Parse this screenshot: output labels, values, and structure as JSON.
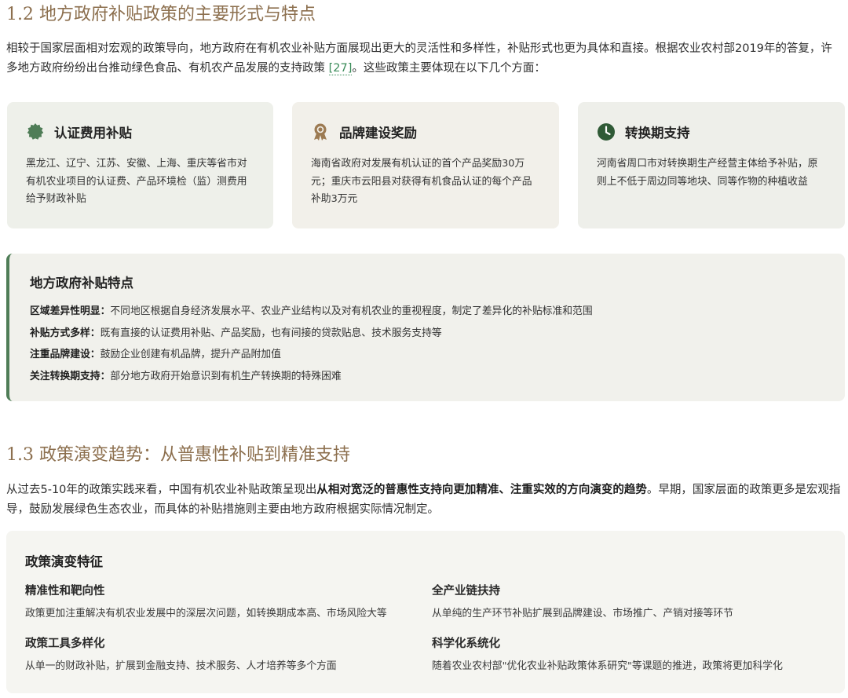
{
  "section_12": {
    "heading": "1.2 地方政府补贴政策的主要形式与特点",
    "para_before_cite": "相较于国家层面相对宏观的政策导向，地方政府在有机农业补贴方面展现出更大的灵活性和多样性，补贴形式也更为具体和直接。根据农业农村部2019年的答复，许多地方政府纷纷出台推动绿色食品、有机农产品发展的支持政策 ",
    "citation": "[27]",
    "para_after_cite": "。这些政策主要体现在以下几个方面："
  },
  "cards": [
    {
      "icon": "certificate-badge-icon",
      "title": "认证费用补贴",
      "body": "黑龙江、辽宁、江苏、安徽、上海、重庆等省市对有机农业项目的认证费、产品环境检（监）测费用给予财政补贴"
    },
    {
      "icon": "award-ribbon-icon",
      "title": "品牌建设奖励",
      "body": "海南省政府对发展有机认证的首个产品奖励30万元；重庆市云阳县对获得有机食品认证的每个产品补助3万元"
    },
    {
      "icon": "clock-icon",
      "title": "转换期支持",
      "body": "河南省周口市对转换期生产经营主体给予补贴，原则上不低于周边同等地块、同等作物的种植收益"
    }
  ],
  "features": {
    "title": "地方政府补贴特点",
    "items": [
      {
        "label": "区域差异性明显：",
        "text": "不同地区根据自身经济发展水平、农业产业结构以及对有机农业的重视程度，制定了差异化的补贴标准和范围"
      },
      {
        "label": "补贴方式多样：",
        "text": "既有直接的认证费用补贴、产品奖励，也有间接的贷款贴息、技术服务支持等"
      },
      {
        "label": "注重品牌建设：",
        "text": "鼓励企业创建有机品牌，提升产品附加值"
      },
      {
        "label": "关注转换期支持：",
        "text": "部分地方政府开始意识到有机生产转换期的特殊困难"
      }
    ]
  },
  "section_13": {
    "heading": "1.3 政策演变趋势：从普惠性补贴到精准支持",
    "para_a": "从过去5-10年的政策实践来看，中国有机农业补贴政策呈现出",
    "para_bold": "从相对宽泛的普惠性支持向更加精准、注重实效的方向演变的趋势",
    "para_b": "。早期，国家层面的政策更多是宏观指导，鼓励发展绿色生态农业，而具体的补贴措施则主要由地方政府根据实际情况制定。"
  },
  "evolution": {
    "title": "政策演变特征",
    "items": [
      {
        "title": "精准性和靶向性",
        "desc": "政策更加注重解决有机农业发展中的深层次问题，如转换期成本高、市场风险大等"
      },
      {
        "title": "全产业链扶持",
        "desc": "从单纯的生产环节补贴扩展到品牌建设、市场推广、产销对接等环节"
      },
      {
        "title": "政策工具多样化",
        "desc": "从单一的财政补贴，扩展到金融支持、技术服务、人才培养等多个方面"
      },
      {
        "title": "科学化系统化",
        "desc": "随着农业农村部\"优化农业补贴政策体系研究\"等课题的推进，政策将更加科学化"
      }
    ]
  },
  "colors": {
    "heading": "#8c6f4e",
    "accent_green": "#4f7d57",
    "citation": "#3b8c5a"
  }
}
